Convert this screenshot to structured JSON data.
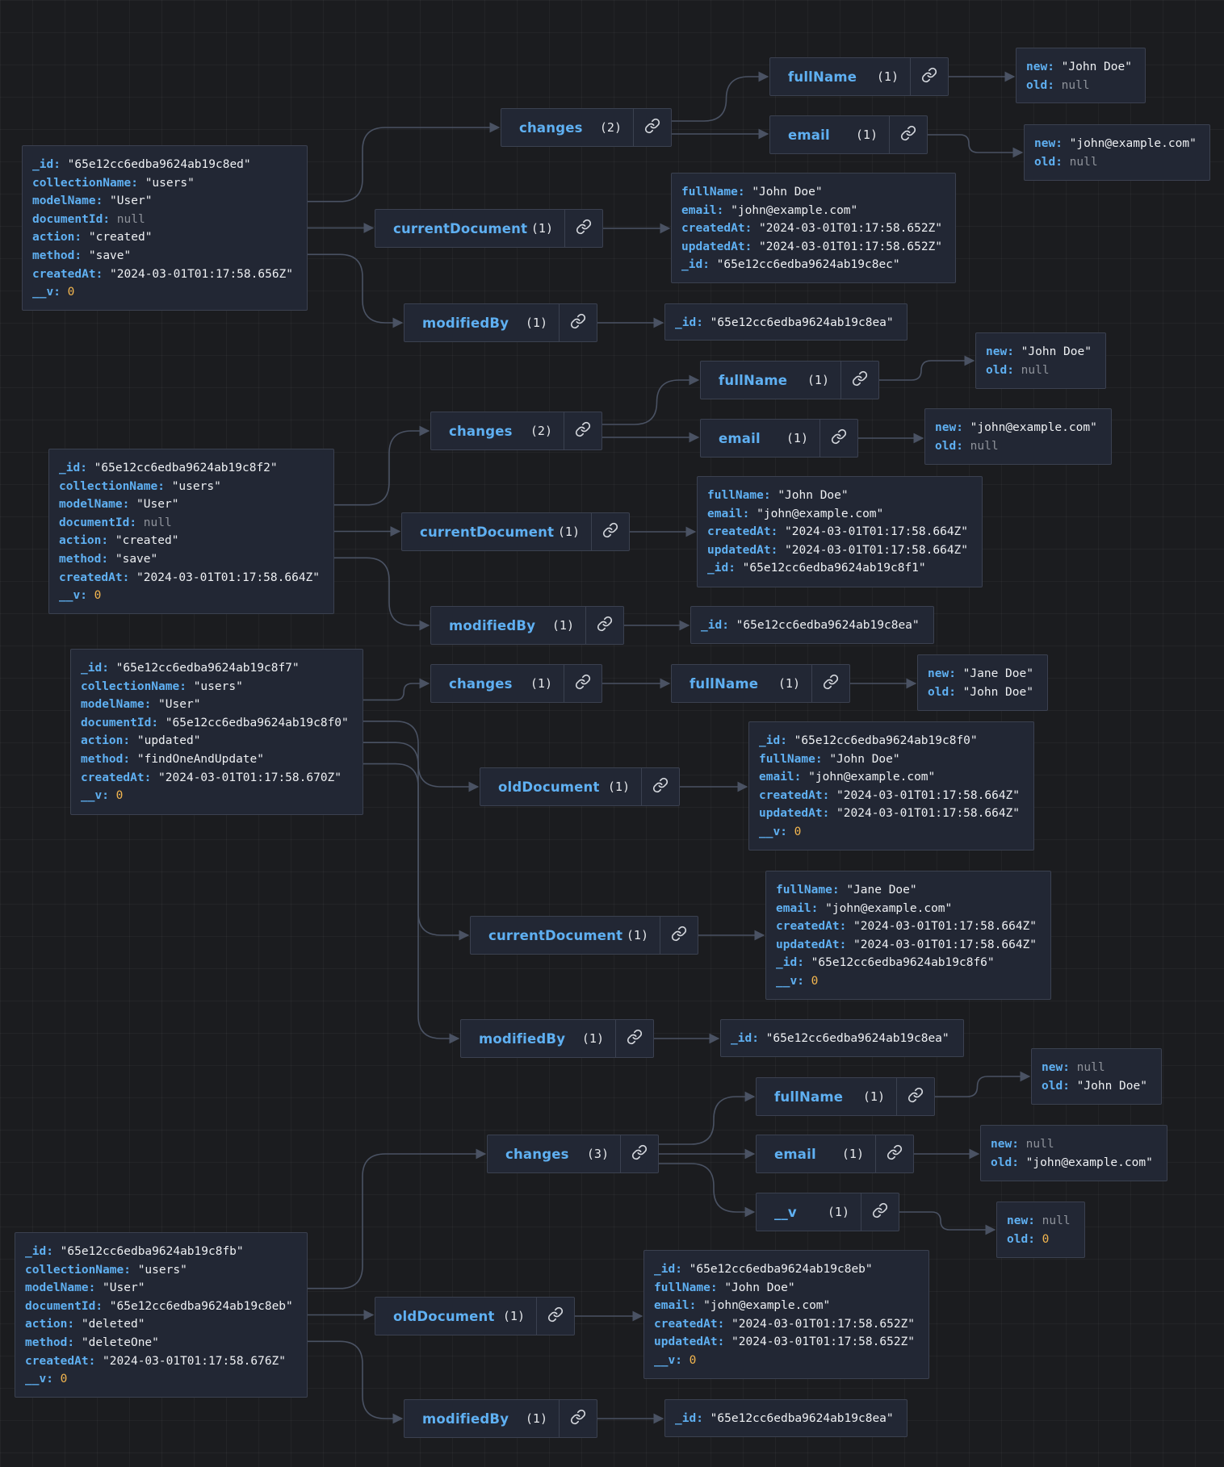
{
  "groups": [
    {
      "id": "g1",
      "key": "changes",
      "count": "(2)"
    },
    {
      "id": "g2",
      "key": "currentDocument",
      "count": "(1)"
    },
    {
      "id": "g3",
      "key": "modifiedBy",
      "count": "(1)"
    },
    {
      "id": "g4",
      "key": "fullName",
      "count": "(1)"
    },
    {
      "id": "g5",
      "key": "email",
      "count": "(1)"
    },
    {
      "id": "g6",
      "key": "changes",
      "count": "(2)"
    },
    {
      "id": "g7",
      "key": "currentDocument",
      "count": "(1)"
    },
    {
      "id": "g8",
      "key": "modifiedBy",
      "count": "(1)"
    },
    {
      "id": "g9",
      "key": "fullName",
      "count": "(1)"
    },
    {
      "id": "g10",
      "key": "email",
      "count": "(1)"
    },
    {
      "id": "g11",
      "key": "changes",
      "count": "(1)"
    },
    {
      "id": "g12",
      "key": "fullName",
      "count": "(1)"
    },
    {
      "id": "g13",
      "key": "oldDocument",
      "count": "(1)"
    },
    {
      "id": "g14",
      "key": "currentDocument",
      "count": "(1)"
    },
    {
      "id": "g15",
      "key": "modifiedBy",
      "count": "(1)"
    },
    {
      "id": "g16",
      "key": "changes",
      "count": "(3)"
    },
    {
      "id": "g17",
      "key": "fullName",
      "count": "(1)"
    },
    {
      "id": "g18",
      "key": "email",
      "count": "(1)"
    },
    {
      "id": "g19",
      "key": "__v",
      "count": "(1)"
    },
    {
      "id": "g20",
      "key": "oldDocument",
      "count": "(1)"
    },
    {
      "id": "g21",
      "key": "modifiedBy",
      "count": "(1)"
    }
  ],
  "objects": [
    {
      "id": "o1",
      "rows": [
        {
          "k": "_id",
          "v": "\"65e12cc6edba9624ab19c8ed\"",
          "t": "s"
        },
        {
          "k": "collectionName",
          "v": "\"users\"",
          "t": "s"
        },
        {
          "k": "modelName",
          "v": "\"User\"",
          "t": "s"
        },
        {
          "k": "documentId",
          "v": "null",
          "t": "null"
        },
        {
          "k": "action",
          "v": "\"created\"",
          "t": "s"
        },
        {
          "k": "method",
          "v": "\"save\"",
          "t": "s"
        },
        {
          "k": "createdAt",
          "v": "\"2024-03-01T01:17:58.656Z\"",
          "t": "s"
        },
        {
          "k": "__v",
          "v": "0",
          "t": "num"
        }
      ]
    },
    {
      "id": "o2",
      "rows": [
        {
          "k": "fullName",
          "v": "\"John Doe\"",
          "t": "s"
        },
        {
          "k": "email",
          "v": "\"john@example.com\"",
          "t": "s"
        },
        {
          "k": "createdAt",
          "v": "\"2024-03-01T01:17:58.652Z\"",
          "t": "s"
        },
        {
          "k": "updatedAt",
          "v": "\"2024-03-01T01:17:58.652Z\"",
          "t": "s"
        },
        {
          "k": "_id",
          "v": "\"65e12cc6edba9624ab19c8ec\"",
          "t": "s"
        }
      ]
    },
    {
      "id": "o3",
      "rows": [
        {
          "k": "_id",
          "v": "\"65e12cc6edba9624ab19c8ea\"",
          "t": "s"
        }
      ]
    },
    {
      "id": "o4",
      "rows": [
        {
          "k": "new",
          "v": "\"John Doe\"",
          "t": "s"
        },
        {
          "k": "old",
          "v": "null",
          "t": "null"
        }
      ]
    },
    {
      "id": "o5",
      "rows": [
        {
          "k": "new",
          "v": "\"john@example.com\"",
          "t": "s"
        },
        {
          "k": "old",
          "v": "null",
          "t": "null"
        }
      ]
    },
    {
      "id": "o6",
      "rows": [
        {
          "k": "_id",
          "v": "\"65e12cc6edba9624ab19c8f2\"",
          "t": "s"
        },
        {
          "k": "collectionName",
          "v": "\"users\"",
          "t": "s"
        },
        {
          "k": "modelName",
          "v": "\"User\"",
          "t": "s"
        },
        {
          "k": "documentId",
          "v": "null",
          "t": "null"
        },
        {
          "k": "action",
          "v": "\"created\"",
          "t": "s"
        },
        {
          "k": "method",
          "v": "\"save\"",
          "t": "s"
        },
        {
          "k": "createdAt",
          "v": "\"2024-03-01T01:17:58.664Z\"",
          "t": "s"
        },
        {
          "k": "__v",
          "v": "0",
          "t": "num"
        }
      ]
    },
    {
      "id": "o7",
      "rows": [
        {
          "k": "fullName",
          "v": "\"John Doe\"",
          "t": "s"
        },
        {
          "k": "email",
          "v": "\"john@example.com\"",
          "t": "s"
        },
        {
          "k": "createdAt",
          "v": "\"2024-03-01T01:17:58.664Z\"",
          "t": "s"
        },
        {
          "k": "updatedAt",
          "v": "\"2024-03-01T01:17:58.664Z\"",
          "t": "s"
        },
        {
          "k": "_id",
          "v": "\"65e12cc6edba9624ab19c8f1\"",
          "t": "s"
        }
      ]
    },
    {
      "id": "o8",
      "rows": [
        {
          "k": "_id",
          "v": "\"65e12cc6edba9624ab19c8ea\"",
          "t": "s"
        }
      ]
    },
    {
      "id": "o9",
      "rows": [
        {
          "k": "new",
          "v": "\"John Doe\"",
          "t": "s"
        },
        {
          "k": "old",
          "v": "null",
          "t": "null"
        }
      ]
    },
    {
      "id": "o10",
      "rows": [
        {
          "k": "new",
          "v": "\"john@example.com\"",
          "t": "s"
        },
        {
          "k": "old",
          "v": "null",
          "t": "null"
        }
      ]
    },
    {
      "id": "o11",
      "rows": [
        {
          "k": "_id",
          "v": "\"65e12cc6edba9624ab19c8f7\"",
          "t": "s"
        },
        {
          "k": "collectionName",
          "v": "\"users\"",
          "t": "s"
        },
        {
          "k": "modelName",
          "v": "\"User\"",
          "t": "s"
        },
        {
          "k": "documentId",
          "v": "\"65e12cc6edba9624ab19c8f0\"",
          "t": "s"
        },
        {
          "k": "action",
          "v": "\"updated\"",
          "t": "s"
        },
        {
          "k": "method",
          "v": "\"findOneAndUpdate\"",
          "t": "s"
        },
        {
          "k": "createdAt",
          "v": "\"2024-03-01T01:17:58.670Z\"",
          "t": "s"
        },
        {
          "k": "__v",
          "v": "0",
          "t": "num"
        }
      ]
    },
    {
      "id": "o12",
      "rows": [
        {
          "k": "new",
          "v": "\"Jane Doe\"",
          "t": "s"
        },
        {
          "k": "old",
          "v": "\"John Doe\"",
          "t": "s"
        }
      ]
    },
    {
      "id": "o13",
      "rows": [
        {
          "k": "_id",
          "v": "\"65e12cc6edba9624ab19c8f0\"",
          "t": "s"
        },
        {
          "k": "fullName",
          "v": "\"John Doe\"",
          "t": "s"
        },
        {
          "k": "email",
          "v": "\"john@example.com\"",
          "t": "s"
        },
        {
          "k": "createdAt",
          "v": "\"2024-03-01T01:17:58.664Z\"",
          "t": "s"
        },
        {
          "k": "updatedAt",
          "v": "\"2024-03-01T01:17:58.664Z\"",
          "t": "s"
        },
        {
          "k": "__v",
          "v": "0",
          "t": "num"
        }
      ]
    },
    {
      "id": "o14",
      "rows": [
        {
          "k": "fullName",
          "v": "\"Jane Doe\"",
          "t": "s"
        },
        {
          "k": "email",
          "v": "\"john@example.com\"",
          "t": "s"
        },
        {
          "k": "createdAt",
          "v": "\"2024-03-01T01:17:58.664Z\"",
          "t": "s"
        },
        {
          "k": "updatedAt",
          "v": "\"2024-03-01T01:17:58.664Z\"",
          "t": "s"
        },
        {
          "k": "_id",
          "v": "\"65e12cc6edba9624ab19c8f6\"",
          "t": "s"
        },
        {
          "k": "__v",
          "v": "0",
          "t": "num"
        }
      ]
    },
    {
      "id": "o15",
      "rows": [
        {
          "k": "_id",
          "v": "\"65e12cc6edba9624ab19c8ea\"",
          "t": "s"
        }
      ]
    },
    {
      "id": "o16",
      "rows": [
        {
          "k": "_id",
          "v": "\"65e12cc6edba9624ab19c8fb\"",
          "t": "s"
        },
        {
          "k": "collectionName",
          "v": "\"users\"",
          "t": "s"
        },
        {
          "k": "modelName",
          "v": "\"User\"",
          "t": "s"
        },
        {
          "k": "documentId",
          "v": "\"65e12cc6edba9624ab19c8eb\"",
          "t": "s"
        },
        {
          "k": "action",
          "v": "\"deleted\"",
          "t": "s"
        },
        {
          "k": "method",
          "v": "\"deleteOne\"",
          "t": "s"
        },
        {
          "k": "createdAt",
          "v": "\"2024-03-01T01:17:58.676Z\"",
          "t": "s"
        },
        {
          "k": "__v",
          "v": "0",
          "t": "num"
        }
      ]
    },
    {
      "id": "o17",
      "rows": [
        {
          "k": "new",
          "v": "null",
          "t": "null"
        },
        {
          "k": "old",
          "v": "\"John Doe\"",
          "t": "s"
        }
      ]
    },
    {
      "id": "o18",
      "rows": [
        {
          "k": "new",
          "v": "null",
          "t": "null"
        },
        {
          "k": "old",
          "v": "\"john@example.com\"",
          "t": "s"
        }
      ]
    },
    {
      "id": "o19",
      "rows": [
        {
          "k": "new",
          "v": "null",
          "t": "null"
        },
        {
          "k": "old",
          "v": "0",
          "t": "num"
        }
      ]
    },
    {
      "id": "o20",
      "rows": [
        {
          "k": "_id",
          "v": "\"65e12cc6edba9624ab19c8eb\"",
          "t": "s"
        },
        {
          "k": "fullName",
          "v": "\"John Doe\"",
          "t": "s"
        },
        {
          "k": "email",
          "v": "\"john@example.com\"",
          "t": "s"
        },
        {
          "k": "createdAt",
          "v": "\"2024-03-01T01:17:58.652Z\"",
          "t": "s"
        },
        {
          "k": "updatedAt",
          "v": "\"2024-03-01T01:17:58.652Z\"",
          "t": "s"
        },
        {
          "k": "__v",
          "v": "0",
          "t": "num"
        }
      ]
    },
    {
      "id": "o21",
      "rows": [
        {
          "k": "_id",
          "v": "\"65e12cc6edba9624ab19c8ea\"",
          "t": "s"
        }
      ]
    }
  ],
  "edges": [
    [
      "o1",
      "g1"
    ],
    [
      "o1",
      "g2"
    ],
    [
      "o1",
      "g3"
    ],
    [
      "g1",
      "g4"
    ],
    [
      "g1",
      "g5"
    ],
    [
      "g4",
      "o4"
    ],
    [
      "g5",
      "o5"
    ],
    [
      "g2",
      "o2"
    ],
    [
      "g3",
      "o3"
    ],
    [
      "o6",
      "g6"
    ],
    [
      "o6",
      "g7"
    ],
    [
      "o6",
      "g8"
    ],
    [
      "g6",
      "g9"
    ],
    [
      "g6",
      "g10"
    ],
    [
      "g9",
      "o9"
    ],
    [
      "g10",
      "o10"
    ],
    [
      "g7",
      "o7"
    ],
    [
      "g8",
      "o8"
    ],
    [
      "o11",
      "g11"
    ],
    [
      "o11",
      "g13"
    ],
    [
      "o11",
      "g14"
    ],
    [
      "o11",
      "g15"
    ],
    [
      "g11",
      "g12"
    ],
    [
      "g12",
      "o12"
    ],
    [
      "g13",
      "o13"
    ],
    [
      "g14",
      "o14"
    ],
    [
      "g15",
      "o15"
    ],
    [
      "o16",
      "g16"
    ],
    [
      "o16",
      "g20"
    ],
    [
      "o16",
      "g21"
    ],
    [
      "g16",
      "g17"
    ],
    [
      "g16",
      "g18"
    ],
    [
      "g16",
      "g19"
    ],
    [
      "g17",
      "o17"
    ],
    [
      "g18",
      "o18"
    ],
    [
      "g19",
      "o19"
    ],
    [
      "g20",
      "o20"
    ],
    [
      "g21",
      "o21"
    ]
  ],
  "colors": {
    "edge": "#4a5263",
    "key": "#5fb0f2",
    "string": "#eef0f3",
    "null": "#8f939b",
    "number": "#f3b64f"
  },
  "icons": {
    "group_button": "link-icon"
  }
}
